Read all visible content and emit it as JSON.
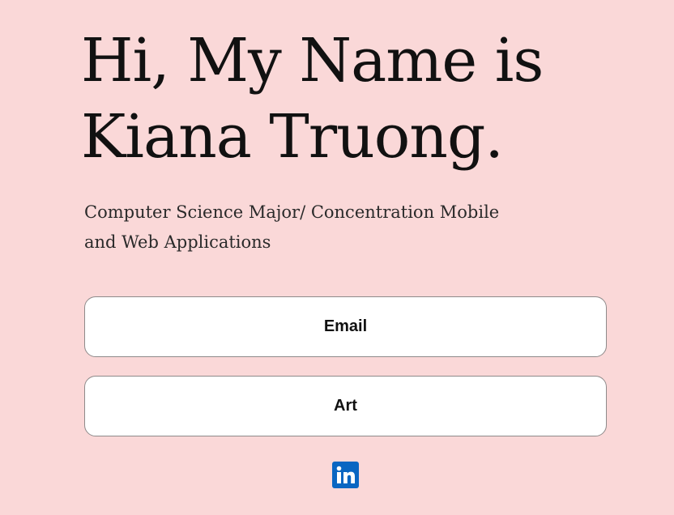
{
  "hero": {
    "headline_line1": "Hi, My Name is",
    "headline_line2": "Kiana Truong.",
    "subtitle_line1": "Computer Science Major/ Concentration Mobile",
    "subtitle_line2": "and Web Applications"
  },
  "buttons": {
    "email_label": "Email",
    "art_label": "Art"
  },
  "social": {
    "linkedin_icon": "linkedin-icon",
    "linkedin_color": "#0a66c2",
    "linkedin_glyph": "in"
  },
  "colors": {
    "background": "#fad8d8",
    "button_background": "#ffffff",
    "text": "#111111"
  }
}
